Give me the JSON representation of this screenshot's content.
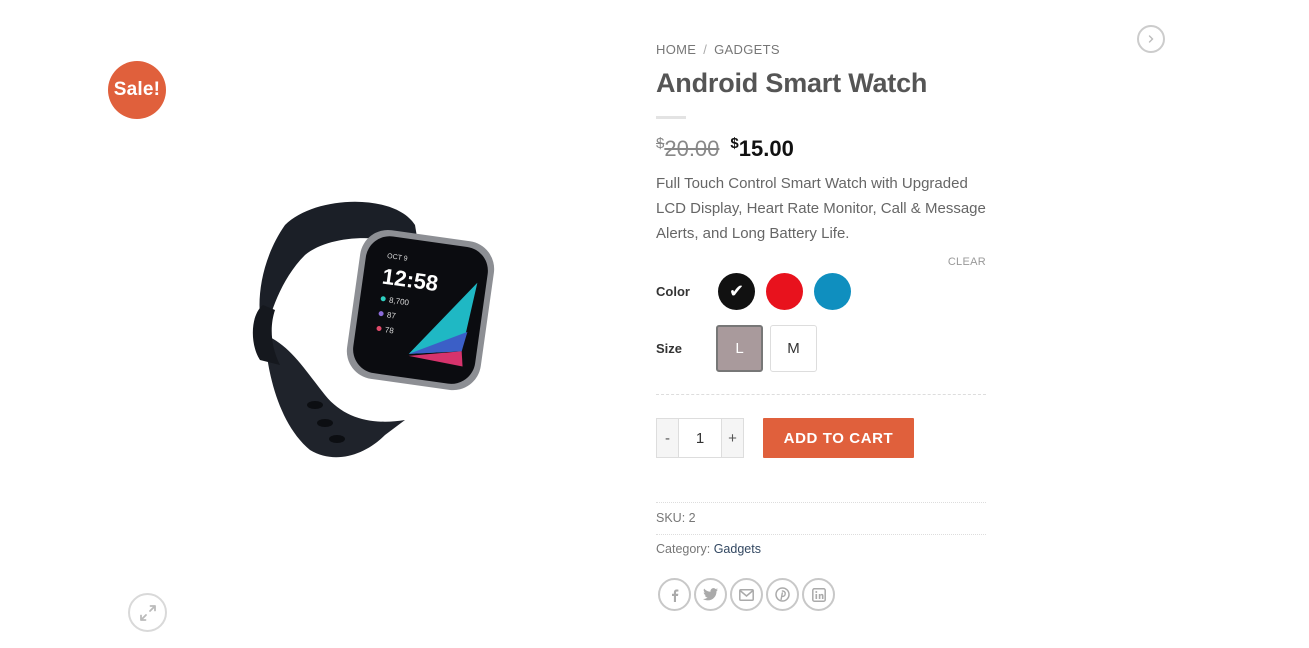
{
  "gallery": {
    "sale_badge": "Sale!",
    "watch_screen": {
      "date": "OCT 9",
      "time": "12:58",
      "steps": "8,700",
      "stat2": "87",
      "heart": "78"
    }
  },
  "breadcrumb": {
    "home": "HOME",
    "separator": "/",
    "category": "GADGETS"
  },
  "product": {
    "title": "Android Smart Watch",
    "currency": "$",
    "old_price": "20.00",
    "new_price": "15.00",
    "description": "Full Touch Control Smart Watch with Upgraded LCD Display, Heart Rate Monitor, Call & Message Alerts, and Long Battery Life."
  },
  "variations": {
    "clear_label": "CLEAR",
    "color_label": "Color",
    "colors": [
      {
        "name": "black",
        "hex": "#111111",
        "selected": true,
        "check": "✔"
      },
      {
        "name": "red",
        "hex": "#e8121d",
        "selected": false
      },
      {
        "name": "blue",
        "hex": "#0f8fbf",
        "selected": false
      }
    ],
    "size_label": "Size",
    "sizes": [
      {
        "label": "L",
        "selected": true
      },
      {
        "label": "M",
        "selected": false
      }
    ]
  },
  "cart": {
    "minus": "-",
    "quantity": "1",
    "plus": "+",
    "add_to_cart": "ADD TO CART"
  },
  "meta": {
    "sku_label": "SKU:",
    "sku_value": "2",
    "category_label": "Category:",
    "category_value": "Gadgets"
  },
  "share": [
    "facebook-icon",
    "twitter-icon",
    "email-icon",
    "pinterest-icon",
    "linkedin-icon"
  ],
  "colors": {
    "accent": "#e0603c",
    "link": "#334862"
  }
}
